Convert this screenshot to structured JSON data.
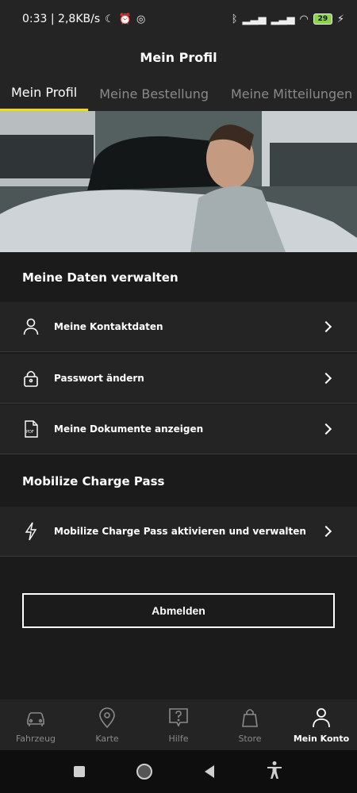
{
  "status_bar": {
    "time_speed": "0:33 | 2,8KB/s",
    "battery": "29"
  },
  "header": {
    "title": "Mein Profil"
  },
  "tabs": [
    {
      "label": "Mein Profil",
      "active": true
    },
    {
      "label": "Meine Bestellung",
      "active": false
    },
    {
      "label": "Meine Mitteilungen",
      "active": false
    }
  ],
  "sections": {
    "data_title": "Meine Daten verwalten",
    "charge_title": "Mobilize Charge Pass"
  },
  "rows": {
    "contact": "Meine Kontaktdaten",
    "password": "Passwort ändern",
    "documents": "Meine Dokumente anzeigen",
    "charge": "Mobilize Charge Pass aktivieren und verwalten"
  },
  "logout_label": "Abmelden",
  "bottom_nav": [
    {
      "label": "Fahrzeug",
      "icon": "car-icon"
    },
    {
      "label": "Karte",
      "icon": "map-pin-icon"
    },
    {
      "label": "Hilfe",
      "icon": "help-icon"
    },
    {
      "label": "Store",
      "icon": "shopping-bag-icon"
    },
    {
      "label": "Mein Konto",
      "icon": "user-icon"
    }
  ],
  "colors": {
    "accent": "#efdf00",
    "background": "#1b1b1b",
    "row": "#242424"
  }
}
